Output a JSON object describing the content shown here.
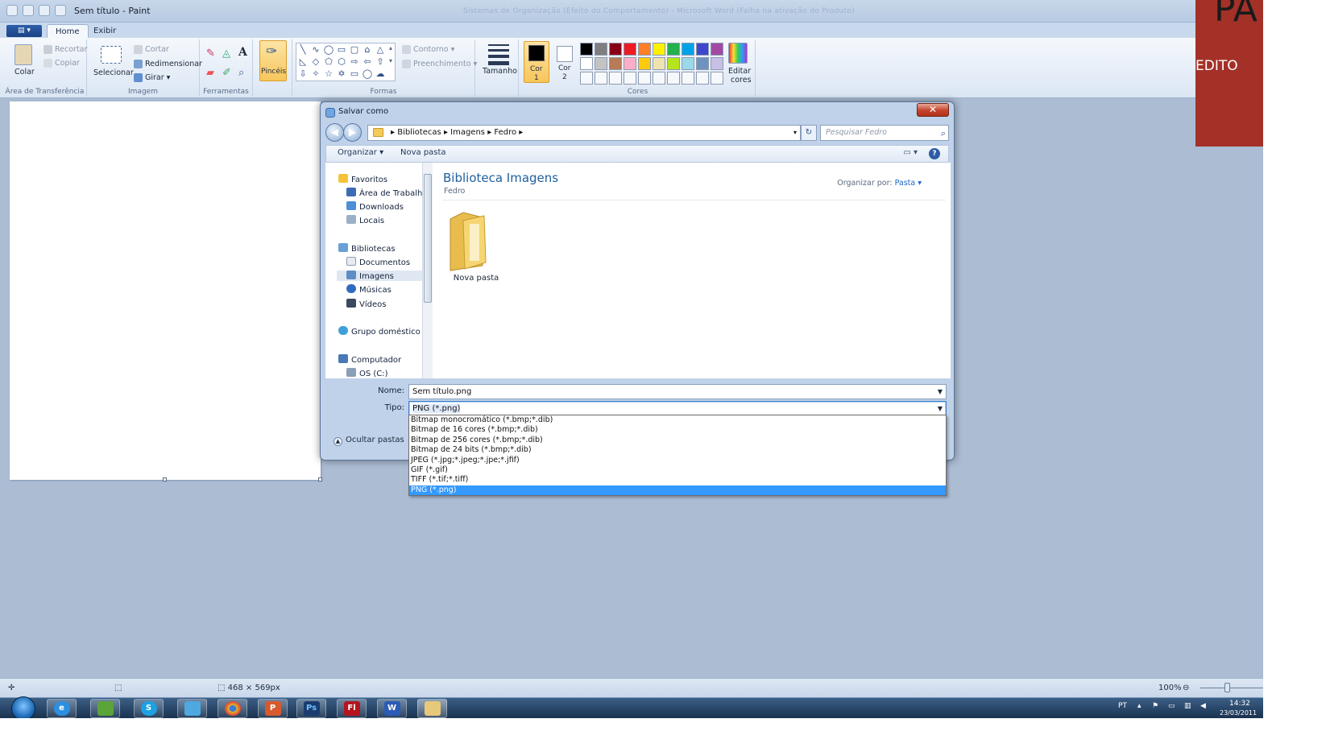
{
  "window": {
    "title": "Sem título - Paint",
    "faint_title": "Sistemas de Organização (Efeito do Comportamento) - Microsoft Word (Falha na ativação do Produto)"
  },
  "ribbon_tabs": {
    "file": "",
    "home": "Home",
    "view": "Exibir"
  },
  "ribbon": {
    "paste": "Colar",
    "cut": "Recortar",
    "copy": "Copiar",
    "clipboard_group": "Área de Transferência",
    "select": "Selecionar",
    "crop": "Cortar",
    "resize": "Redimensionar",
    "rotate": "Girar ▾",
    "image_group": "Imagem",
    "tools_group": "Ferramentas",
    "brushes": "Pincéis",
    "outline": "Contorno ▾",
    "fill": "Preenchimento ▾",
    "shapes_group": "Formas",
    "size": "Tamanho",
    "color1": "Cor",
    "color1_num": "1",
    "color2": "Cor",
    "color2_num": "2",
    "colors_group": "Cores",
    "edit_colors": "Editar",
    "edit_colors2": "cores"
  },
  "palette_row1": [
    "#000000",
    "#7f7f7f",
    "#880015",
    "#ed1c24",
    "#ff7f27",
    "#fff200",
    "#22b14c",
    "#00a2e8",
    "#3f48cc",
    "#a349a4"
  ],
  "palette_row2": [
    "#ffffff",
    "#c3c3c3",
    "#b97a57",
    "#ffaec9",
    "#ffc90e",
    "#efe4b0",
    "#b5e61d",
    "#99d9ea",
    "#7092be",
    "#c8bfe7"
  ],
  "dialog": {
    "title": "Salvar como",
    "breadcrumb": "▸ Bibliotecas ▸ Imagens ▸ Fedro ▸",
    "search_placeholder": "Pesquisar Fedro",
    "organize": "Organizar ▾",
    "new_folder": "Nova pasta",
    "nav": {
      "favorites": "Favoritos",
      "desktop": "Área de Trabalho",
      "downloads": "Downloads",
      "places": "Locais",
      "libraries": "Bibliotecas",
      "documents": "Documentos",
      "images": "Imagens",
      "music": "Músicas",
      "videos": "Vídeos",
      "homegroup": "Grupo doméstico",
      "computer": "Computador",
      "drive": "OS (C:)"
    },
    "library_title": "Biblioteca Imagens",
    "library_sub": "Fedro",
    "sort_label": "Organizar por:",
    "sort_value": "Pasta ▾",
    "folder_name": "Nova pasta",
    "name_label": "Nome:",
    "name_value": "Sem título.png",
    "type_label": "Tipo:",
    "type_value": "PNG (*.png)",
    "hide_folders": "Ocultar pastas"
  },
  "type_options": [
    "Bitmap monocromático (*.bmp;*.dib)",
    "Bitmap de 16 cores (*.bmp;*.dib)",
    "Bitmap de 256 cores (*.bmp;*.dib)",
    "Bitmap de 24 bits (*.bmp;*.dib)",
    "JPEG (*.jpg;*.jpeg;*.jpe;*.jfif)",
    "GIF (*.gif)",
    "TIFF (*.tif;*.tiff)",
    "PNG (*.png)"
  ],
  "status": {
    "dimensions": "468 × 569px",
    "zoom": "100%"
  },
  "tray": {
    "lang": "PT",
    "time": "14:32",
    "date": "23/03/2011"
  },
  "overlay": {
    "title": "PA",
    "subtitle": "EDITO"
  }
}
